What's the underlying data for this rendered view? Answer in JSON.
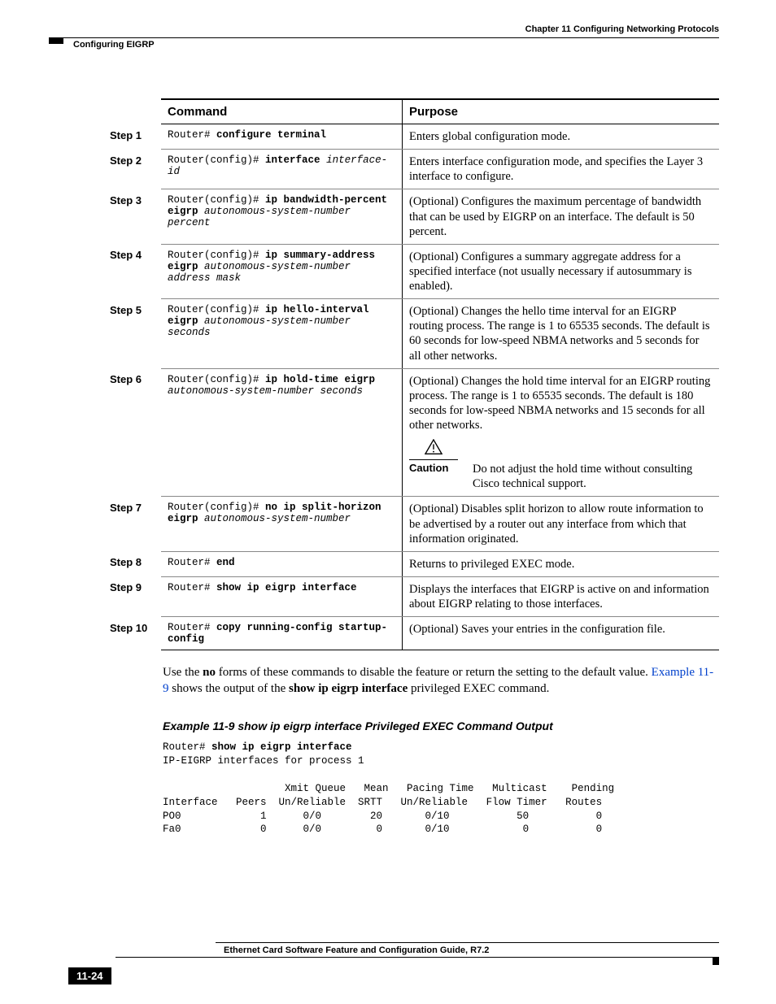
{
  "header": {
    "chapter": "Chapter 11  Configuring Networking Protocols",
    "section": "Configuring EIGRP"
  },
  "table": {
    "head_command": "Command",
    "head_purpose": "Purpose",
    "rows": [
      {
        "step": "Step 1",
        "prompt": "Router# ",
        "cmd_bold": "configure terminal",
        "cmd_ital": "",
        "cmd_raw_html": "Router# <b>configure terminal</b>",
        "purpose": "Enters global configuration mode."
      },
      {
        "step": "Step 2",
        "cmd_raw_html": "Router(config)# <b>interface</b> <i>interface-id</i>",
        "purpose": "Enters interface configuration mode, and specifies the Layer 3 interface to configure."
      },
      {
        "step": "Step 3",
        "cmd_raw_html": "Router(config)# <b>ip bandwidth-percent eigrp</b> <i>autonomous-system-number percent</i>",
        "purpose": "(Optional) Configures the maximum percentage of bandwidth that can be used by EIGRP on an interface. The default is 50 percent."
      },
      {
        "step": "Step 4",
        "cmd_raw_html": "Router(config)# <b>ip summary-address eigrp</b> <i>autonomous-system-number address mask</i>",
        "purpose": "(Optional) Configures a summary aggregate address for a specified interface (not usually necessary if autosummary is enabled)."
      },
      {
        "step": "Step 5",
        "cmd_raw_html": "Router(config)# <b>ip hello-interval eigrp</b> <i>autonomous-system-number seconds</i>",
        "purpose": "(Optional) Changes the hello time interval for an EIGRP routing process. The range is 1 to 65535 seconds. The default is 60 seconds for low-speed NBMA networks and 5 seconds for all other networks."
      },
      {
        "step": "Step 6",
        "cmd_raw_html": "Router(config)# <b>ip hold-time eigrp</b> <i>autonomous-system-number seconds</i>",
        "purpose": "(Optional) Changes the hold time interval for an EIGRP routing process. The range is 1 to 65535 seconds. The default is 180 seconds for low-speed NBMA networks and 15 seconds for all other networks.",
        "caution_label": "Caution",
        "caution_text": "Do not adjust the hold time without consulting Cisco technical support."
      },
      {
        "step": "Step 7",
        "cmd_raw_html": "Router(config)# <b>no ip split-horizon eigrp</b> <i>autonomous-system-number</i>",
        "purpose": "(Optional) Disables split horizon to allow route information to be advertised by a router out any interface from which that information originated."
      },
      {
        "step": "Step 8",
        "cmd_raw_html": "Router# <b>end</b>",
        "purpose": "Returns to privileged EXEC mode."
      },
      {
        "step": "Step 9",
        "cmd_raw_html": "Router# <b>show ip eigrp interface</b>",
        "purpose": "Displays the interfaces that EIGRP is active on and information about EIGRP relating to those interfaces."
      },
      {
        "step": "Step 10",
        "cmd_raw_html": "Router# <b>copy running-config startup-config</b>",
        "purpose": "(Optional) Saves your entries in the configuration file."
      }
    ]
  },
  "body": {
    "para1_pre": "Use the ",
    "para1_bold1": "no",
    "para1_mid": " forms of these commands to disable the feature or return the setting to the default value. ",
    "para1_link": "Example 11-9",
    "para1_post1": " shows the output of the ",
    "para1_bold2": "show ip eigrp interface",
    "para1_post2": " privileged EXEC command."
  },
  "example": {
    "title": "Example 11-9   show ip eigrp interface Privileged EXEC Command Output",
    "cli_prompt": "Router# ",
    "cli_cmd": "show ip eigrp interface",
    "cli_line2": "IP-EIGRP interfaces for process 1",
    "cli_table": "                    Xmit Queue   Mean   Pacing Time   Multicast    Pending\nInterface   Peers  Un/Reliable  SRTT   Un/Reliable   Flow Timer   Routes\nPO0             1      0/0        20       0/10           50           0\nFa0             0      0/0         0       0/10            0           0"
  },
  "footer": {
    "title": "Ethernet Card Software Feature and Configuration Guide, R7.2",
    "page": "11-24"
  }
}
